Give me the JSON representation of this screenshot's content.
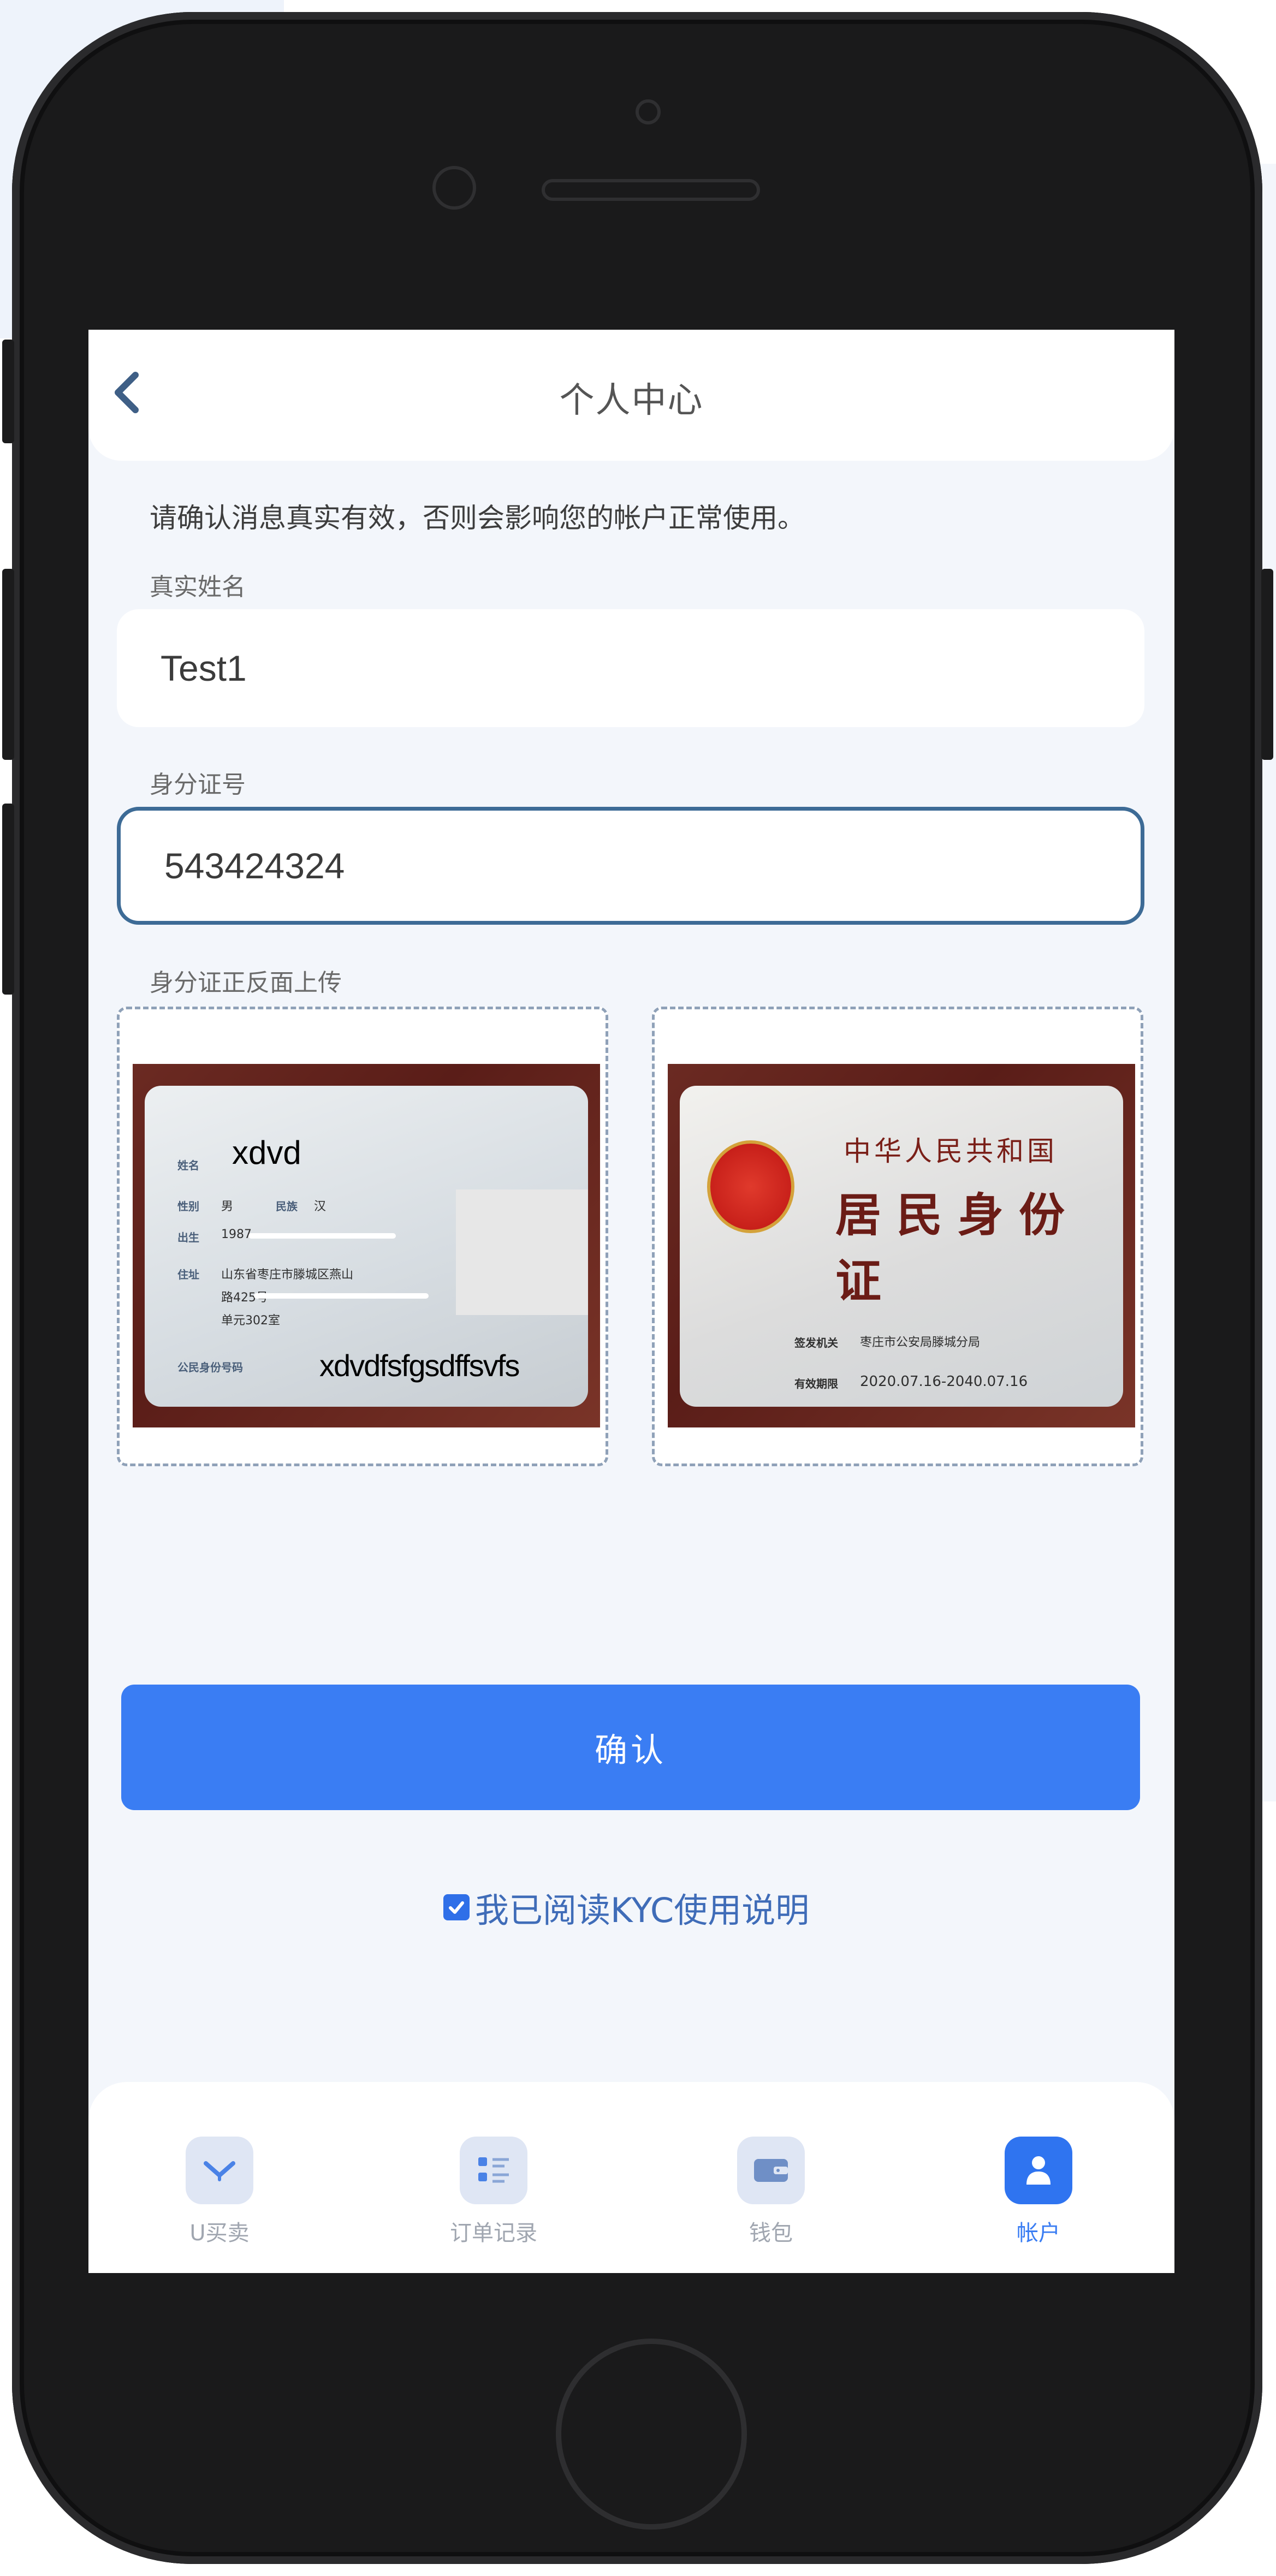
{
  "header": {
    "title": "个人中心"
  },
  "notice": "请确认消息真实有效，否则会影响您的帐户正常使用。",
  "form": {
    "name_label": "真实姓名",
    "name_value": "Test1",
    "id_label": "身分证号",
    "id_value": "543424324",
    "upload_label": "身分证正反面上传"
  },
  "id_front": {
    "overlay_name": "xdvd",
    "overlay_number": "xdvdfsfgsdffsvfs",
    "labels": {
      "name": "姓名",
      "gender": "性别",
      "birth": "出生",
      "address": "住址",
      "id_number": "公民身份号码"
    },
    "gender_value": "男",
    "ethnicity_label": "民族",
    "ethnicity_value": "汉",
    "birth_year": "1987",
    "address_line1": "山东省枣庄市滕城区燕山",
    "address_line2": "路425号",
    "address_line3": "单元302室"
  },
  "id_back": {
    "title_line1": "中华人民共和国",
    "title_line2": "居民身份证",
    "authority_label": "签发机关",
    "authority_value": "枣庄市公安局滕城分局",
    "validity_label": "有效期限",
    "validity_value": "2020.07.16-2040.07.16"
  },
  "agreement": {
    "checked": true,
    "label": "我已阅读KYC使用说明"
  },
  "confirm_label": "确认",
  "tabs": [
    {
      "label": "U买卖",
      "icon": "exchange-icon",
      "active": false
    },
    {
      "label": "订单记录",
      "icon": "order-list-icon",
      "active": false
    },
    {
      "label": "钱包",
      "icon": "wallet-icon",
      "active": false
    },
    {
      "label": "帐户",
      "icon": "account-icon",
      "active": true
    }
  ],
  "colors": {
    "primary": "#3a7df3",
    "focus_border": "#3d6b96",
    "background": "#f3f6fb"
  }
}
